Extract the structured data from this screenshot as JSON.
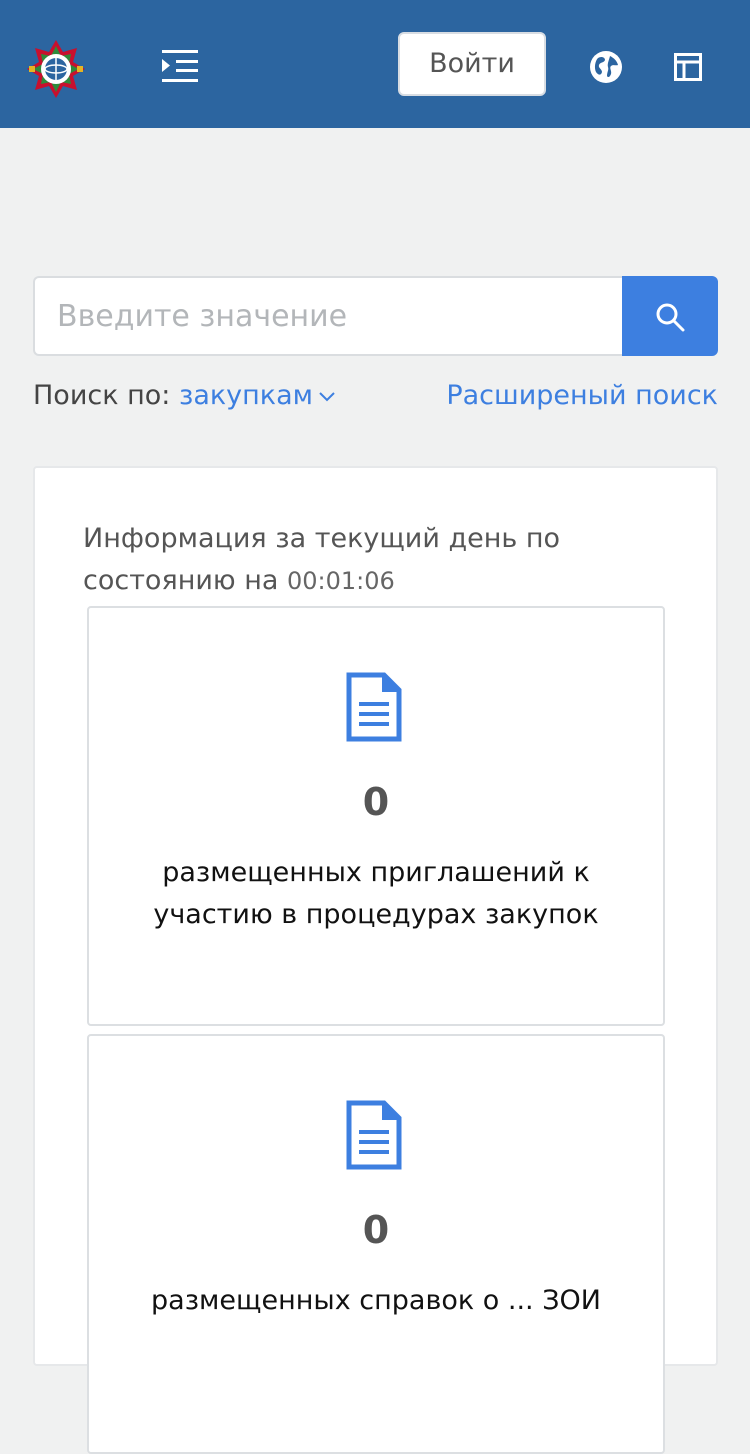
{
  "header": {
    "login_label": "Войти",
    "icons": [
      "logo-emblem",
      "menu-indent-icon",
      "globe-icon",
      "layout-panel-icon"
    ],
    "colors": {
      "header_bg": "#2c65a0",
      "accent": "#3d7fe0"
    }
  },
  "search": {
    "placeholder": "Введите значение",
    "search_by_label": "Поиск по:",
    "search_by_value": "закупкам",
    "advanced_link": "Расширеный поиск"
  },
  "info": {
    "text": "Информация за текущий день по состоянию на",
    "time": "00:01:06"
  },
  "cards": [
    {
      "count": "0",
      "label": "размещенных приглашений к участию в процедурах закупок"
    },
    {
      "count": "0",
      "label": "размещенных справок о ... ЗОИ"
    }
  ]
}
